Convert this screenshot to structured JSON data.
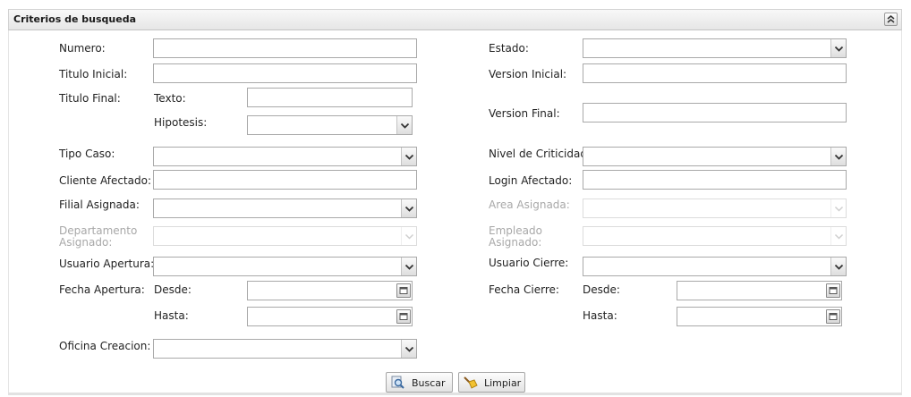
{
  "panel": {
    "title": "Criterios de busqueda"
  },
  "labels": {
    "numero": "Numero:",
    "titulo_inicial": "Titulo Inicial:",
    "titulo_final": "Titulo Final:",
    "texto": "Texto:",
    "hipotesis": "Hipotesis:",
    "tipo_caso": "Tipo Caso:",
    "cliente_afectado": "Cliente Afectado:",
    "filial_asignada": "Filial Asignada:",
    "departamento_asignado": "Departamento Asignado:",
    "usuario_apertura": "Usuario Apertura:",
    "fecha_apertura": "Fecha Apertura:",
    "desde": "Desde:",
    "hasta": "Hasta:",
    "oficina_creacion": "Oficina Creacion:",
    "estado": "Estado:",
    "version_inicial": "Version Inicial:",
    "version_final": "Version Final:",
    "nivel_criticidad": "Nivel de Criticidad:",
    "login_afectado": "Login Afectado:",
    "area_asignada": "Area Asignada:",
    "empleado_asignado": "Empleado Asignado:",
    "usuario_cierre": "Usuario Cierre:",
    "fecha_cierre": "Fecha Cierre:"
  },
  "values": {
    "numero": "",
    "titulo_inicial": "",
    "texto": "",
    "hipotesis": "",
    "tipo_caso": "",
    "cliente_afectado": "",
    "filial_asignada": "",
    "departamento_asignado": "",
    "usuario_apertura": "",
    "fecha_apertura_desde": "",
    "fecha_apertura_hasta": "",
    "oficina_creacion": "",
    "estado": "",
    "version_inicial": "",
    "version_final": "",
    "nivel_criticidad": "",
    "login_afectado": "",
    "area_asignada": "",
    "empleado_asignado": "",
    "usuario_cierre": "",
    "fecha_cierre_desde": "",
    "fecha_cierre_hasta": ""
  },
  "buttons": {
    "buscar": "Buscar",
    "limpiar": "Limpiar"
  },
  "icons": {
    "collapse": "double-chevron-up-icon",
    "dropdown": "chevron-down-icon",
    "calendar": "calendar-icon",
    "search": "magnifier-icon",
    "clear": "broom-icon"
  },
  "colors": {
    "header_bg": "#e9e9e9",
    "disabled_text": "#a8a8a8",
    "border": "#a9a9a9"
  }
}
